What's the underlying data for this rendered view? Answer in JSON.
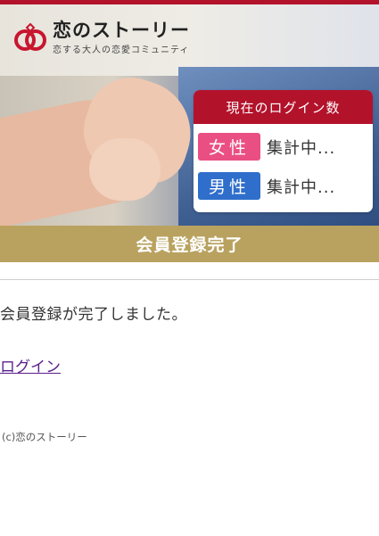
{
  "header": {
    "brand_title": "恋のストーリー",
    "brand_tagline": "恋する大人の恋愛コミュニティ"
  },
  "login_panel": {
    "title": "現在のログイン数",
    "female_label": "女性",
    "female_count": "集計中...",
    "male_label": "男性",
    "male_count": "集計中..."
  },
  "banner": {
    "title": "会員登録完了"
  },
  "main": {
    "message": "会員登録が完了しました。",
    "login_link": "ログイン"
  },
  "footer": {
    "copyright": "(c)恋のストーリー"
  },
  "colors": {
    "accent_red": "#b3122b",
    "gold": "#b9a25f",
    "female_pink": "#ea4f83",
    "male_blue": "#2f6ecb",
    "link": "#5a1f8a"
  }
}
